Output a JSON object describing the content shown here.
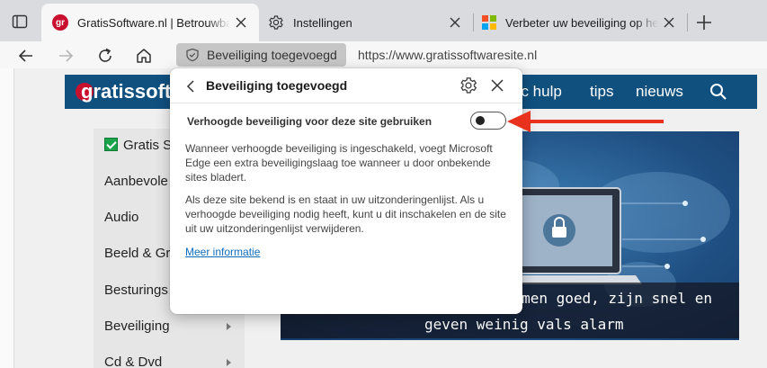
{
  "browser": {
    "tabs": [
      {
        "title": "GratisSoftware.nl | Betrouwbare gratis software",
        "favicon": "gr",
        "active": true
      },
      {
        "title": "Instellingen",
        "favicon": "gear-icon",
        "active": false
      },
      {
        "title": "Verbeter uw beveiliging op het web",
        "favicon": "microsoft-logo",
        "active": false
      }
    ],
    "site_chip_label": "Beveiliging toegevoegd",
    "url": "https://www.gratissoftwaresite.nl"
  },
  "site": {
    "logo_text": "gratissoft",
    "nav": [
      "oc hulp",
      "tips",
      "nieuws"
    ],
    "sidebar_items": [
      {
        "label": "Gratis S"
      },
      {
        "label": "Aanbevole"
      },
      {
        "label": "Audio"
      },
      {
        "label": "Beeld & Gr"
      },
      {
        "label": "Besturings"
      },
      {
        "label": "Beveiliging"
      },
      {
        "label": "Cd & Dvd"
      }
    ],
    "hero_caption_line1": "nermen goed, zijn snel en",
    "hero_caption_line2": "geven weinig vals alarm"
  },
  "popup": {
    "title": "Beveiliging toegevoegd",
    "toggle_label": "Verhoogde beveiliging voor deze site gebruiken",
    "toggle_on": false,
    "paragraph1": "Wanneer verhoogde beveiliging is ingeschakeld, voegt Microsoft Edge een extra beveiligingslaag toe wanneer u door onbekende sites bladert.",
    "paragraph2": "Als deze site bekend is en staat in uw uitzonderingenlijst. Als u verhoogde beveiliging nodig heeft, kunt u dit inschakelen en de site uit uw uitzonderingenlijst verwijderen.",
    "link": "Meer informatie"
  },
  "colors": {
    "site_header": "#10507f",
    "brand_red": "#c8102e",
    "link_blue": "#0f6cbd",
    "annotation_arrow": "#e8321e"
  }
}
